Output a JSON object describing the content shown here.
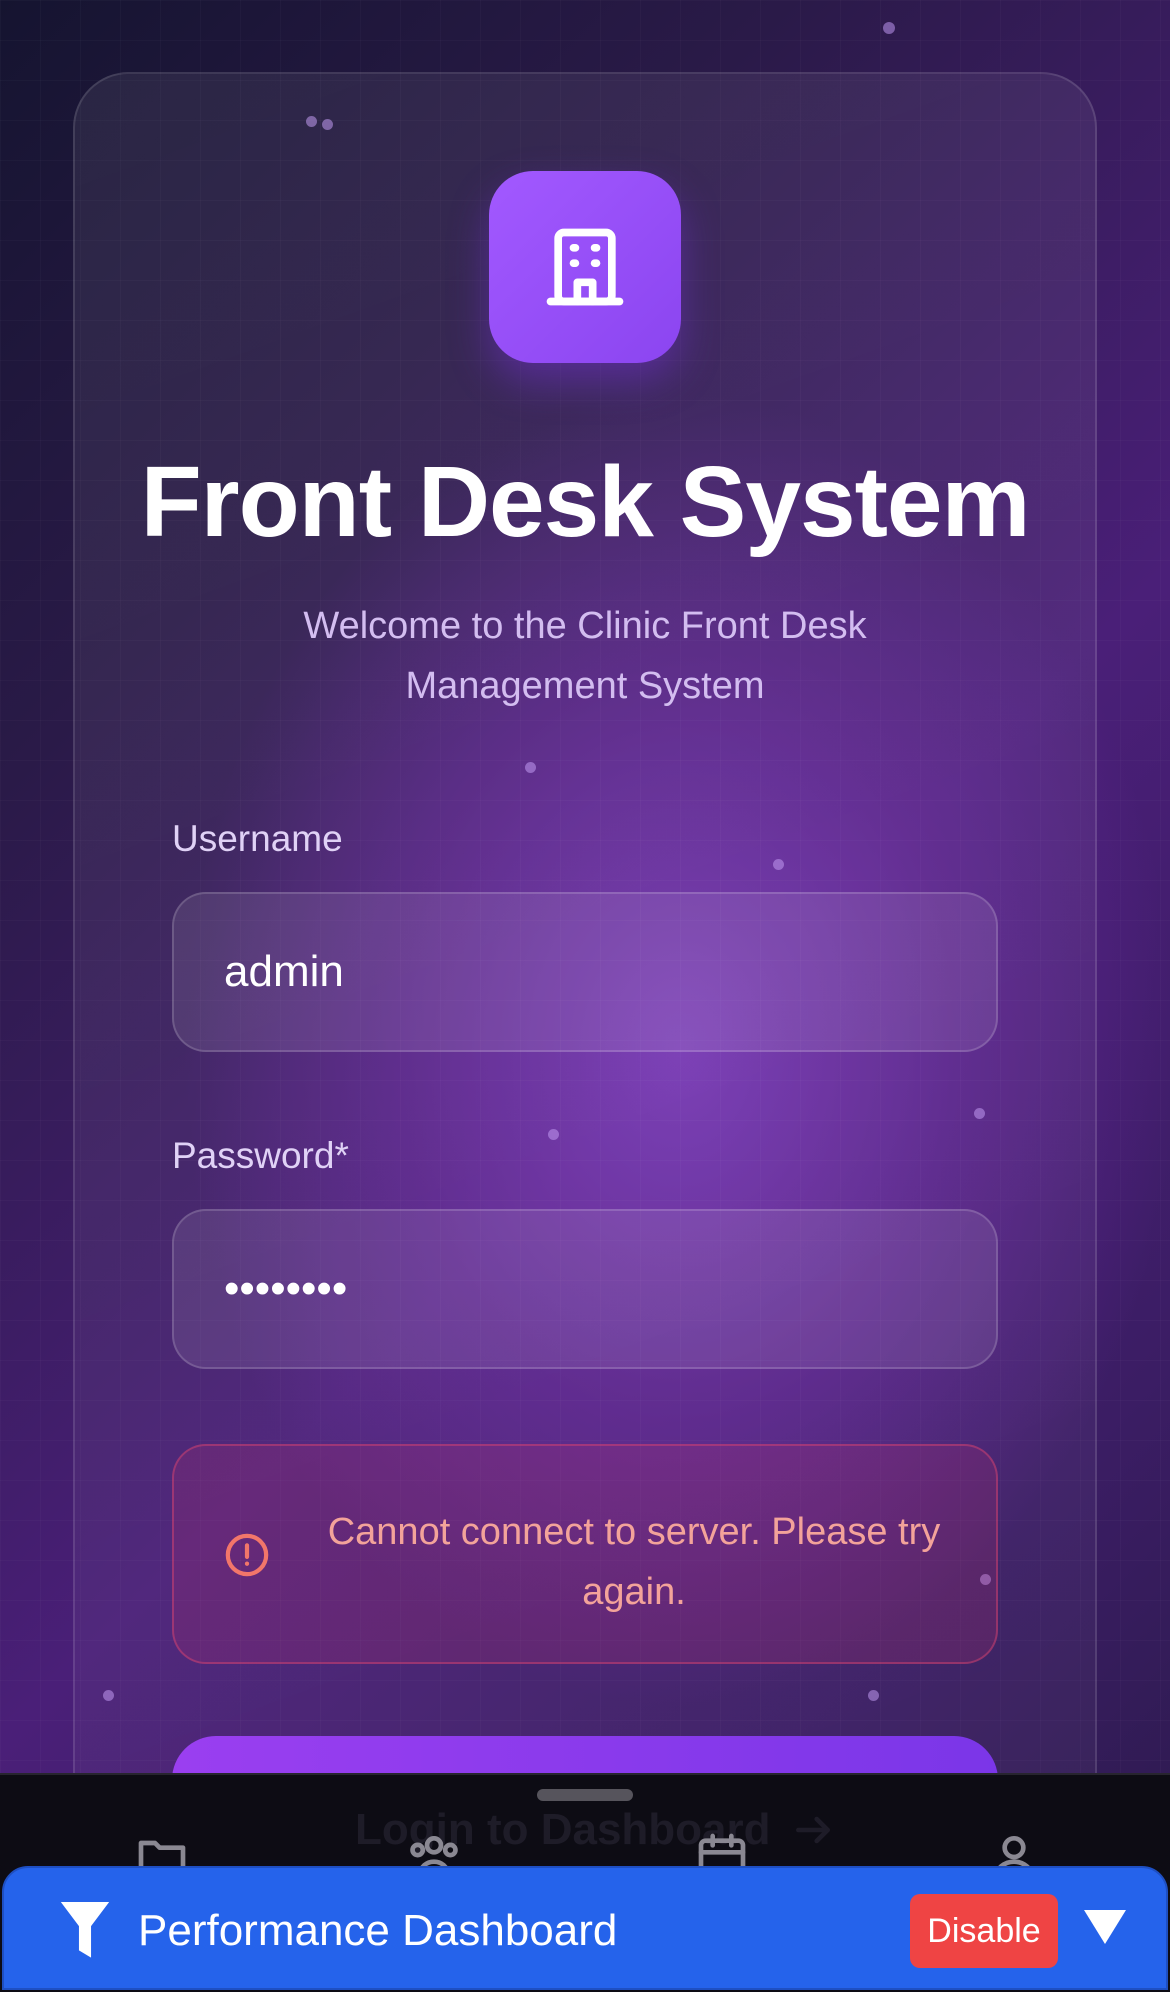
{
  "app": {
    "title": "Front Desk System",
    "subtitle": "Welcome to the Clinic Front Desk Management System"
  },
  "form": {
    "username_label": "Username",
    "username_value": "admin",
    "password_label": "Password*",
    "password_value": "••••••••",
    "error_message": "Cannot connect to server. Please try again.",
    "login_label": "Login to Dashboard"
  },
  "nav": {
    "items": [
      {
        "icon": "folder-icon"
      },
      {
        "icon": "users-icon"
      },
      {
        "icon": "calendar-icon"
      },
      {
        "icon": "user-icon"
      }
    ]
  },
  "perf": {
    "title": "Performance Dashboard",
    "disable_label": "Disable"
  },
  "colors": {
    "accent": "#9a3ff0",
    "logo": "#a259ff",
    "error_text": "#f3a39a",
    "perf_bar": "#2563eb",
    "disable": "#ef4444"
  },
  "icons": {
    "logo": "building-icon",
    "error": "alert-circle-icon",
    "perf": "funnel-icon",
    "collapse": "triangle-down-icon",
    "login_arrow": "arrow-right-icon"
  }
}
